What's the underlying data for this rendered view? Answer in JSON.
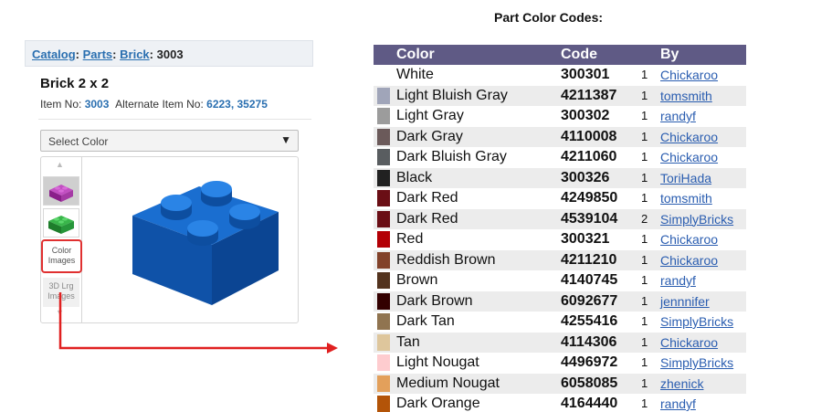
{
  "breadcrumb": {
    "catalog": "Catalog",
    "sep1": ":",
    "parts": "Parts",
    "sep2": ":",
    "brick": "Brick",
    "sep3": ":",
    "item": "3003"
  },
  "item": {
    "title": "Brick 2 x 2",
    "item_no_label": "Item No:",
    "item_no": "3003",
    "alt_label": "Alternate Item No:",
    "alt_items": "6223, 35275"
  },
  "select_color": {
    "placeholder": "Select Color",
    "arrow_icon": "chevron-down-icon"
  },
  "thumbnails": {
    "color_images_line1": "Color",
    "color_images_line2": "Images",
    "lrg_images_line1": "3D Lrg",
    "lrg_images_line2": "Images"
  },
  "colors": {
    "brick_blue": "#1565c0",
    "arrow_red": "#e02020",
    "header_bg": "#5f5a85"
  },
  "table": {
    "title": "Part Color Codes:",
    "headers": {
      "color": "Color",
      "code": "Code",
      "by": "By"
    },
    "rows": [
      {
        "swatch": "#ffffff",
        "name": "White",
        "code": "300301",
        "count": "1",
        "by": "Chickaroo"
      },
      {
        "swatch": "#a0a5b9",
        "name": "Light Bluish Gray",
        "code": "4211387",
        "count": "1",
        "by": "tomsmith"
      },
      {
        "swatch": "#9c9c9c",
        "name": "Light Gray",
        "code": "300302",
        "count": "1",
        "by": "randyf"
      },
      {
        "swatch": "#6b5a5a",
        "name": "Dark Gray",
        "code": "4110008",
        "count": "1",
        "by": "Chickaroo"
      },
      {
        "swatch": "#595d60",
        "name": "Dark Bluish Gray",
        "code": "4211060",
        "count": "1",
        "by": "Chickaroo"
      },
      {
        "swatch": "#212121",
        "name": "Black",
        "code": "300326",
        "count": "1",
        "by": "ToriHada"
      },
      {
        "swatch": "#6a0e15",
        "name": "Dark Red",
        "code": "4249850",
        "count": "1",
        "by": "tomsmith"
      },
      {
        "swatch": "#6a0e15",
        "name": "Dark Red",
        "code": "4539104",
        "count": "2",
        "by": "SimplyBricks"
      },
      {
        "swatch": "#b30006",
        "name": "Red",
        "code": "300321",
        "count": "1",
        "by": "Chickaroo"
      },
      {
        "swatch": "#82422a",
        "name": "Reddish Brown",
        "code": "4211210",
        "count": "1",
        "by": "Chickaroo"
      },
      {
        "swatch": "#53331e",
        "name": "Brown",
        "code": "4140745",
        "count": "1",
        "by": "randyf"
      },
      {
        "swatch": "#330000",
        "name": "Dark Brown",
        "code": "6092677",
        "count": "1",
        "by": "jennnifer"
      },
      {
        "swatch": "#907450",
        "name": "Dark Tan",
        "code": "4255416",
        "count": "1",
        "by": "SimplyBricks"
      },
      {
        "swatch": "#dec69c",
        "name": "Tan",
        "code": "4114306",
        "count": "1",
        "by": "Chickaroo"
      },
      {
        "swatch": "#fecccf",
        "name": "Light Nougat",
        "code": "4496972",
        "count": "1",
        "by": "SimplyBricks"
      },
      {
        "swatch": "#e3a05b",
        "name": "Medium Nougat",
        "code": "6058085",
        "count": "1",
        "by": "zhenick"
      },
      {
        "swatch": "#b35408",
        "name": "Dark Orange",
        "code": "4164440",
        "count": "1",
        "by": "randyf"
      }
    ]
  }
}
